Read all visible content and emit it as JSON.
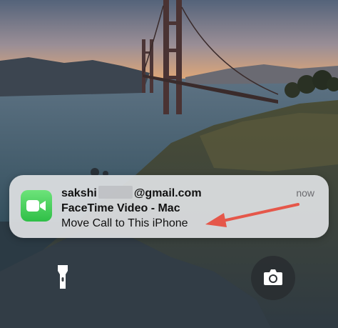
{
  "notification": {
    "app_icon": "facetime-video-icon",
    "sender_prefix": "sakshi",
    "sender_suffix": "@gmail.com",
    "time": "now",
    "title": "FaceTime Video - Mac",
    "body": "Move Call to This iPhone"
  },
  "lockscreen": {
    "left_button_icon": "flashlight-icon",
    "right_button_icon": "camera-icon"
  },
  "colors": {
    "arrow": "#e5574a",
    "facetime_green": "#34c759"
  }
}
